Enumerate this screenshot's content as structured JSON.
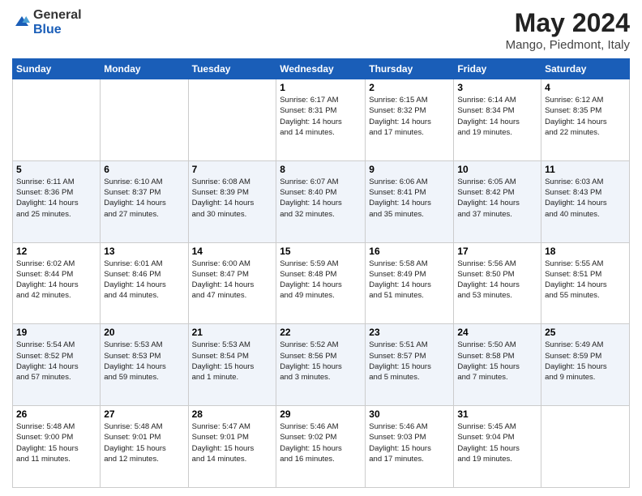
{
  "header": {
    "logo_line1": "General",
    "logo_line2": "Blue",
    "month_year": "May 2024",
    "location": "Mango, Piedmont, Italy"
  },
  "days_of_week": [
    "Sunday",
    "Monday",
    "Tuesday",
    "Wednesday",
    "Thursday",
    "Friday",
    "Saturday"
  ],
  "weeks": [
    [
      {
        "day": "",
        "info": ""
      },
      {
        "day": "",
        "info": ""
      },
      {
        "day": "",
        "info": ""
      },
      {
        "day": "1",
        "info": "Sunrise: 6:17 AM\nSunset: 8:31 PM\nDaylight: 14 hours\nand 14 minutes."
      },
      {
        "day": "2",
        "info": "Sunrise: 6:15 AM\nSunset: 8:32 PM\nDaylight: 14 hours\nand 17 minutes."
      },
      {
        "day": "3",
        "info": "Sunrise: 6:14 AM\nSunset: 8:34 PM\nDaylight: 14 hours\nand 19 minutes."
      },
      {
        "day": "4",
        "info": "Sunrise: 6:12 AM\nSunset: 8:35 PM\nDaylight: 14 hours\nand 22 minutes."
      }
    ],
    [
      {
        "day": "5",
        "info": "Sunrise: 6:11 AM\nSunset: 8:36 PM\nDaylight: 14 hours\nand 25 minutes."
      },
      {
        "day": "6",
        "info": "Sunrise: 6:10 AM\nSunset: 8:37 PM\nDaylight: 14 hours\nand 27 minutes."
      },
      {
        "day": "7",
        "info": "Sunrise: 6:08 AM\nSunset: 8:39 PM\nDaylight: 14 hours\nand 30 minutes."
      },
      {
        "day": "8",
        "info": "Sunrise: 6:07 AM\nSunset: 8:40 PM\nDaylight: 14 hours\nand 32 minutes."
      },
      {
        "day": "9",
        "info": "Sunrise: 6:06 AM\nSunset: 8:41 PM\nDaylight: 14 hours\nand 35 minutes."
      },
      {
        "day": "10",
        "info": "Sunrise: 6:05 AM\nSunset: 8:42 PM\nDaylight: 14 hours\nand 37 minutes."
      },
      {
        "day": "11",
        "info": "Sunrise: 6:03 AM\nSunset: 8:43 PM\nDaylight: 14 hours\nand 40 minutes."
      }
    ],
    [
      {
        "day": "12",
        "info": "Sunrise: 6:02 AM\nSunset: 8:44 PM\nDaylight: 14 hours\nand 42 minutes."
      },
      {
        "day": "13",
        "info": "Sunrise: 6:01 AM\nSunset: 8:46 PM\nDaylight: 14 hours\nand 44 minutes."
      },
      {
        "day": "14",
        "info": "Sunrise: 6:00 AM\nSunset: 8:47 PM\nDaylight: 14 hours\nand 47 minutes."
      },
      {
        "day": "15",
        "info": "Sunrise: 5:59 AM\nSunset: 8:48 PM\nDaylight: 14 hours\nand 49 minutes."
      },
      {
        "day": "16",
        "info": "Sunrise: 5:58 AM\nSunset: 8:49 PM\nDaylight: 14 hours\nand 51 minutes."
      },
      {
        "day": "17",
        "info": "Sunrise: 5:56 AM\nSunset: 8:50 PM\nDaylight: 14 hours\nand 53 minutes."
      },
      {
        "day": "18",
        "info": "Sunrise: 5:55 AM\nSunset: 8:51 PM\nDaylight: 14 hours\nand 55 minutes."
      }
    ],
    [
      {
        "day": "19",
        "info": "Sunrise: 5:54 AM\nSunset: 8:52 PM\nDaylight: 14 hours\nand 57 minutes."
      },
      {
        "day": "20",
        "info": "Sunrise: 5:53 AM\nSunset: 8:53 PM\nDaylight: 14 hours\nand 59 minutes."
      },
      {
        "day": "21",
        "info": "Sunrise: 5:53 AM\nSunset: 8:54 PM\nDaylight: 15 hours\nand 1 minute."
      },
      {
        "day": "22",
        "info": "Sunrise: 5:52 AM\nSunset: 8:56 PM\nDaylight: 15 hours\nand 3 minutes."
      },
      {
        "day": "23",
        "info": "Sunrise: 5:51 AM\nSunset: 8:57 PM\nDaylight: 15 hours\nand 5 minutes."
      },
      {
        "day": "24",
        "info": "Sunrise: 5:50 AM\nSunset: 8:58 PM\nDaylight: 15 hours\nand 7 minutes."
      },
      {
        "day": "25",
        "info": "Sunrise: 5:49 AM\nSunset: 8:59 PM\nDaylight: 15 hours\nand 9 minutes."
      }
    ],
    [
      {
        "day": "26",
        "info": "Sunrise: 5:48 AM\nSunset: 9:00 PM\nDaylight: 15 hours\nand 11 minutes."
      },
      {
        "day": "27",
        "info": "Sunrise: 5:48 AM\nSunset: 9:01 PM\nDaylight: 15 hours\nand 12 minutes."
      },
      {
        "day": "28",
        "info": "Sunrise: 5:47 AM\nSunset: 9:01 PM\nDaylight: 15 hours\nand 14 minutes."
      },
      {
        "day": "29",
        "info": "Sunrise: 5:46 AM\nSunset: 9:02 PM\nDaylight: 15 hours\nand 16 minutes."
      },
      {
        "day": "30",
        "info": "Sunrise: 5:46 AM\nSunset: 9:03 PM\nDaylight: 15 hours\nand 17 minutes."
      },
      {
        "day": "31",
        "info": "Sunrise: 5:45 AM\nSunset: 9:04 PM\nDaylight: 15 hours\nand 19 minutes."
      },
      {
        "day": "",
        "info": ""
      }
    ]
  ]
}
